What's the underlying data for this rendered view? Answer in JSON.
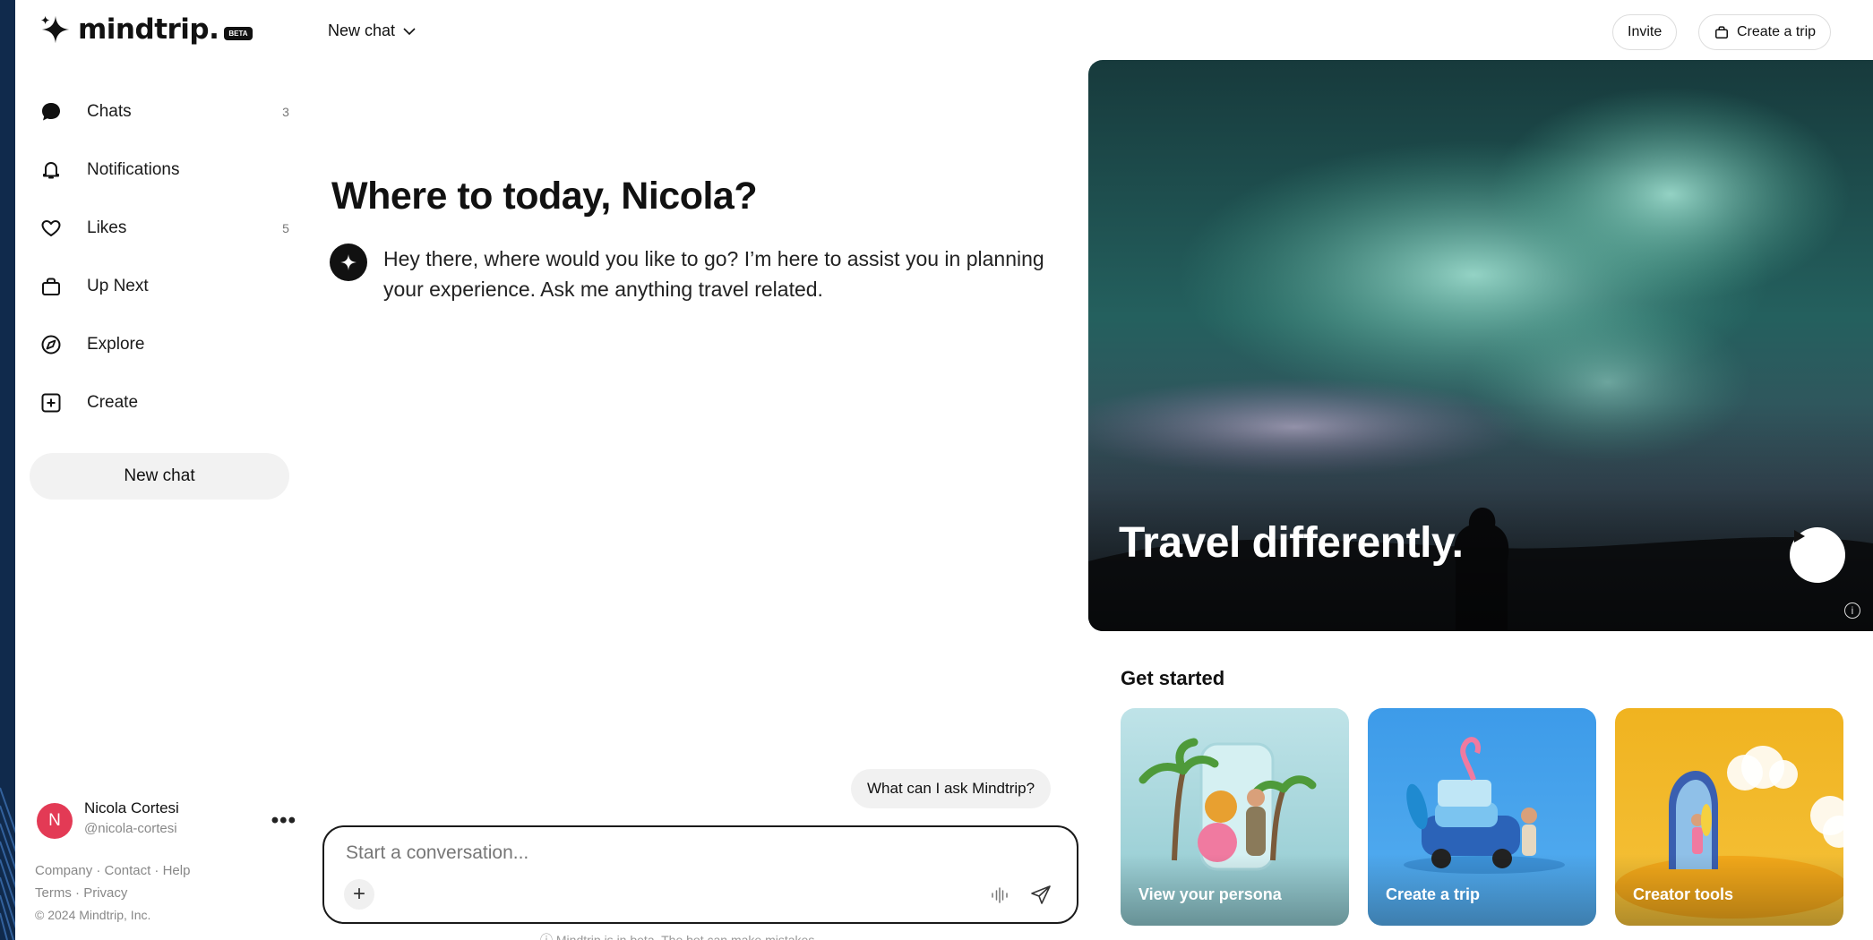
{
  "brand": {
    "name": "mindtrip.",
    "badge": "BETA"
  },
  "sidebar": {
    "items": [
      {
        "label": "Chats",
        "count": "3",
        "icon": "chat-bubble-icon"
      },
      {
        "label": "Notifications",
        "count": "",
        "icon": "bell-icon"
      },
      {
        "label": "Likes",
        "count": "5",
        "icon": "heart-icon"
      },
      {
        "label": "Up Next",
        "count": "",
        "icon": "bag-icon"
      },
      {
        "label": "Explore",
        "count": "",
        "icon": "compass-icon"
      },
      {
        "label": "Create",
        "count": "",
        "icon": "plus-square-icon"
      }
    ],
    "new_chat": "New chat"
  },
  "user": {
    "initial": "N",
    "name": "Nicola Cortesi",
    "handle": "@nicola-cortesi",
    "more": "•••"
  },
  "footer": {
    "company": "Company",
    "contact": "Contact",
    "help": "Help",
    "terms": "Terms",
    "privacy": "Privacy",
    "sep": " · ",
    "copyright": "© 2024 Mindtrip, Inc."
  },
  "chat": {
    "title": "New chat",
    "greeting": "Where to today, Nicola?",
    "message": "Hey there, where would you like to go? I’m here to assist you in planning your experience. Ask me anything travel related.",
    "suggestion": "What can I ask Mindtrip?",
    "placeholder": "Start a conversation...",
    "plus": "+",
    "disclaimer": "ⓘ Mindtrip is in beta. The bot can make mistakes."
  },
  "header": {
    "invite": "Invite",
    "create_trip": "Create a trip"
  },
  "hero": {
    "title": "Travel differently.",
    "info": "i"
  },
  "get_started": {
    "title": "Get started",
    "cards": [
      {
        "label": "View your persona"
      },
      {
        "label": "Create a trip"
      },
      {
        "label": "Creator tools"
      }
    ]
  },
  "colors": {
    "brand_bg": "#102a4c",
    "accent_avatar": "#e33a55",
    "card_blue": "#3d9be9",
    "card_yellow": "#f0b320"
  }
}
